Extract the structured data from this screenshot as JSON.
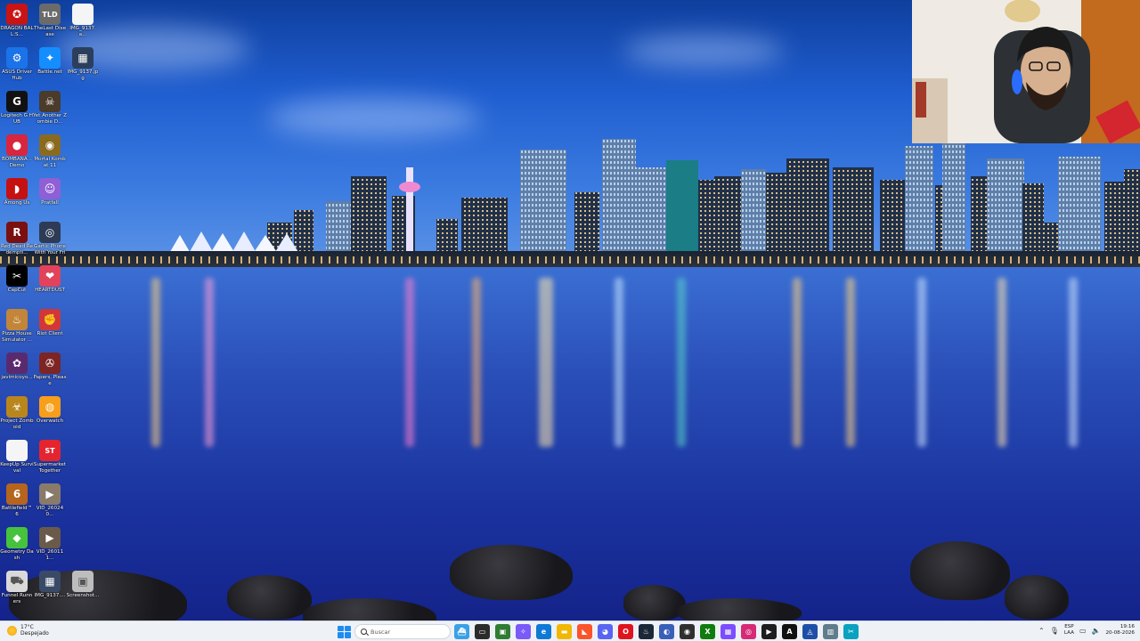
{
  "desktop": {
    "icons": [
      {
        "label": "DRAGON BALL:S...",
        "icon": "dragon-ball-icon",
        "color": "#c81414",
        "glyph": "✪"
      },
      {
        "label": "TheLast Disease",
        "icon": "the-last-disease-icon",
        "color": "#6b6b6b",
        "glyph": "TLD"
      },
      {
        "label": "IMG_9137.a...",
        "icon": "file-icon",
        "color": "#f5f5f5",
        "glyph": ""
      },
      {
        "label": "ASUS DriverHub",
        "icon": "asus-driverhub-icon",
        "color": "#1a73e8",
        "glyph": "⚙"
      },
      {
        "label": "Battle.net",
        "icon": "battlenet-icon",
        "color": "#148eff",
        "glyph": "✦"
      },
      {
        "label": "IMG_9137.jpg",
        "icon": "image-file-icon",
        "color": "#2b3f5c",
        "glyph": "▦"
      },
      {
        "label": "Logitech G HUB",
        "icon": "logitech-ghub-icon",
        "color": "#111111",
        "glyph": "G"
      },
      {
        "label": "Yet Another Zombie D...",
        "icon": "zombie-game-icon",
        "color": "#4a3b2a",
        "glyph": "☠"
      },
      {
        "label": "BOMBANA... Demo",
        "icon": "bombana-icon",
        "color": "#d7263d",
        "glyph": "●"
      },
      {
        "label": "Mortal Kombat 11",
        "icon": "mortal-kombat-icon",
        "color": "#8a6a1f",
        "glyph": "◉"
      },
      {
        "label": "Among Us",
        "icon": "among-us-icon",
        "color": "#c51111",
        "glyph": "◗"
      },
      {
        "label": "Pratfall",
        "icon": "pratfall-icon",
        "color": "#8f5fd6",
        "glyph": "☺"
      },
      {
        "label": "Red Dead Redempti...",
        "icon": "red-dead-icon",
        "color": "#7a1010",
        "glyph": "R"
      },
      {
        "label": "Gartic Phone With Your Friends",
        "icon": "gartic-icon",
        "color": "#2d3b55",
        "glyph": "◎"
      },
      {
        "label": "CapCut",
        "icon": "capcut-icon",
        "color": "#000000",
        "glyph": "✂"
      },
      {
        "label": "HEARTDUST",
        "icon": "heartdust-icon",
        "color": "#e2435a",
        "glyph": "❤"
      },
      {
        "label": "Pizza House Simulator ...",
        "icon": "pizza-house-icon",
        "color": "#c2853a",
        "glyph": "♨"
      },
      {
        "label": "Riot Client",
        "icon": "riot-client-icon",
        "color": "#d13639",
        "glyph": "✊"
      },
      {
        "label": "javimicoyo...",
        "icon": "javimicoyo-icon",
        "color": "#5a2a6e",
        "glyph": "✿"
      },
      {
        "label": "Papers, Please",
        "icon": "papers-please-icon",
        "color": "#7d2424",
        "glyph": "✇"
      },
      {
        "label": "Project Zomboid",
        "icon": "project-zomboid-icon",
        "color": "#b8861b",
        "glyph": "☣"
      },
      {
        "label": "Overwatch",
        "icon": "overwatch-icon",
        "color": "#f99e1a",
        "glyph": "◍"
      },
      {
        "label": "KeepUp Survival",
        "icon": "keepup-file-icon",
        "color": "#f5f5f5",
        "glyph": ""
      },
      {
        "label": "Supermarket Together",
        "icon": "supermarket-together-icon",
        "color": "#e4252f",
        "glyph": "ST"
      },
      {
        "label": "Battlefield™ 6",
        "icon": "battlefield-icon",
        "color": "#b5651d",
        "glyph": "6"
      },
      {
        "label": "VID_260240...",
        "icon": "video-file-icon",
        "color": "#8a7a6a",
        "glyph": "▶"
      },
      {
        "label": "Geometry Dash",
        "icon": "geometry-dash-icon",
        "color": "#46c23c",
        "glyph": "◆"
      },
      {
        "label": "VID_260111...",
        "icon": "video-file-icon",
        "color": "#6a5a4a",
        "glyph": "▶"
      },
      {
        "label": "Funnel Runners",
        "icon": "funnel-runners-icon",
        "color": "#d9d9d9",
        "glyph": "⛟"
      },
      {
        "label": "IMG_9137....",
        "icon": "image-file-icon",
        "color": "#3a4a66",
        "glyph": "▦"
      },
      {
        "label": "Screenshot...",
        "icon": "screenshot-file-icon",
        "color": "#bdbdbd",
        "glyph": "▣"
      }
    ]
  },
  "taskbar": {
    "weather": {
      "temp": "17°C",
      "condition": "Despejado",
      "icon": "sun-icon"
    },
    "start_icon": "windows-start-icon",
    "search_placeholder": "Buscar",
    "apps": [
      {
        "name": "landscape-app-icon",
        "color": "#3aa0e6",
        "glyph": "⛴"
      },
      {
        "name": "task-view-icon",
        "color": "#2b2b2b",
        "glyph": "▭"
      },
      {
        "name": "file-app-icon",
        "color": "#2e7d32",
        "glyph": "▣"
      },
      {
        "name": "copilot-icon",
        "color": "#7a5af8",
        "glyph": "✧"
      },
      {
        "name": "edge-icon",
        "color": "#0f7ad6",
        "glyph": "e"
      },
      {
        "name": "file-explorer-icon",
        "color": "#f2b705",
        "glyph": "▬"
      },
      {
        "name": "brave-icon",
        "color": "#fb542b",
        "glyph": "◣"
      },
      {
        "name": "discord-icon",
        "color": "#5865f2",
        "glyph": "◕"
      },
      {
        "name": "opera-icon",
        "color": "#e0141e",
        "glyph": "O"
      },
      {
        "name": "steam-icon",
        "color": "#1b2838",
        "glyph": "♨"
      },
      {
        "name": "ps-app-icon",
        "color": "#3a5fb8",
        "glyph": "◐"
      },
      {
        "name": "obs-icon",
        "color": "#30302f",
        "glyph": "◉"
      },
      {
        "name": "xbox-icon",
        "color": "#107c10",
        "glyph": "X"
      },
      {
        "name": "grid-app-icon",
        "color": "#7c4dff",
        "glyph": "▦"
      },
      {
        "name": "instagram-icon",
        "color": "#d62976",
        "glyph": "◎"
      },
      {
        "name": "media-player-icon",
        "color": "#1e1e1e",
        "glyph": "▶"
      },
      {
        "name": "text-app-icon",
        "color": "#111111",
        "glyph": "A"
      },
      {
        "name": "app-store-icon",
        "color": "#1e4fa8",
        "glyph": "◬"
      },
      {
        "name": "photos-icon",
        "color": "#607d8b",
        "glyph": "▥"
      },
      {
        "name": "snipping-tool-icon",
        "color": "#0aa2c0",
        "glyph": "✂"
      }
    ],
    "tray": {
      "chevron_icon": "chevron-up-icon",
      "mic_icon": "microphone-icon",
      "lang_primary": "ESP",
      "lang_secondary": "LAA",
      "network_icon": "network-icon",
      "volume_icon": "speaker-icon",
      "time": "19:16",
      "date": "20-08-2026"
    }
  }
}
